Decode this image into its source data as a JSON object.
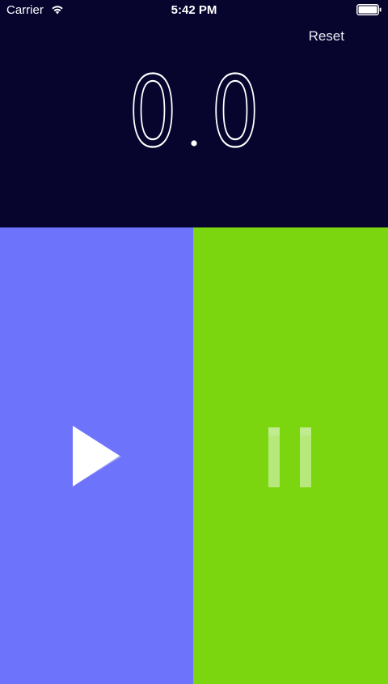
{
  "status_bar": {
    "carrier": "Carrier",
    "time": "5:42 PM",
    "wifi_icon": "wifi-icon",
    "battery_icon": "battery-icon"
  },
  "header": {
    "reset_label": "Reset"
  },
  "timer": {
    "display": "0.0",
    "whole": "0",
    "fraction": "0"
  },
  "controls": {
    "play_icon": "play-icon",
    "pause_icon": "pause-icon"
  },
  "colors": {
    "top_background": "#07042e",
    "play_background": "#6d74fb",
    "pause_background": "#7bd60f",
    "text": "#ffffff"
  }
}
